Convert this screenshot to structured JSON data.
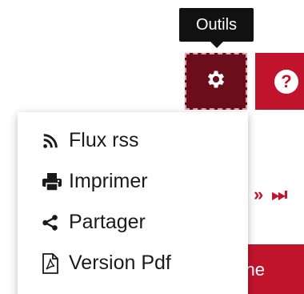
{
  "tooltip": {
    "text": "Outils"
  },
  "toolbar": {
    "tools_button_icon": "gear-icon",
    "help_button_icon": "question-circle-icon",
    "help_glyph": "?",
    "gear_glyph": "⚙"
  },
  "pager": {
    "text": "»  ⏭"
  },
  "search": {
    "label": "erche"
  },
  "menu": {
    "items": [
      {
        "label": "Flux rss",
        "icon": "rss-icon"
      },
      {
        "label": "Imprimer",
        "icon": "print-icon"
      },
      {
        "label": "Partager",
        "icon": "share-icon"
      },
      {
        "label": "Version Pdf",
        "icon": "pdf-file-icon"
      }
    ]
  },
  "colors": {
    "accent": "#c0142d",
    "accent_dark": "#6b0d1a",
    "tooltip_bg": "#111111"
  }
}
